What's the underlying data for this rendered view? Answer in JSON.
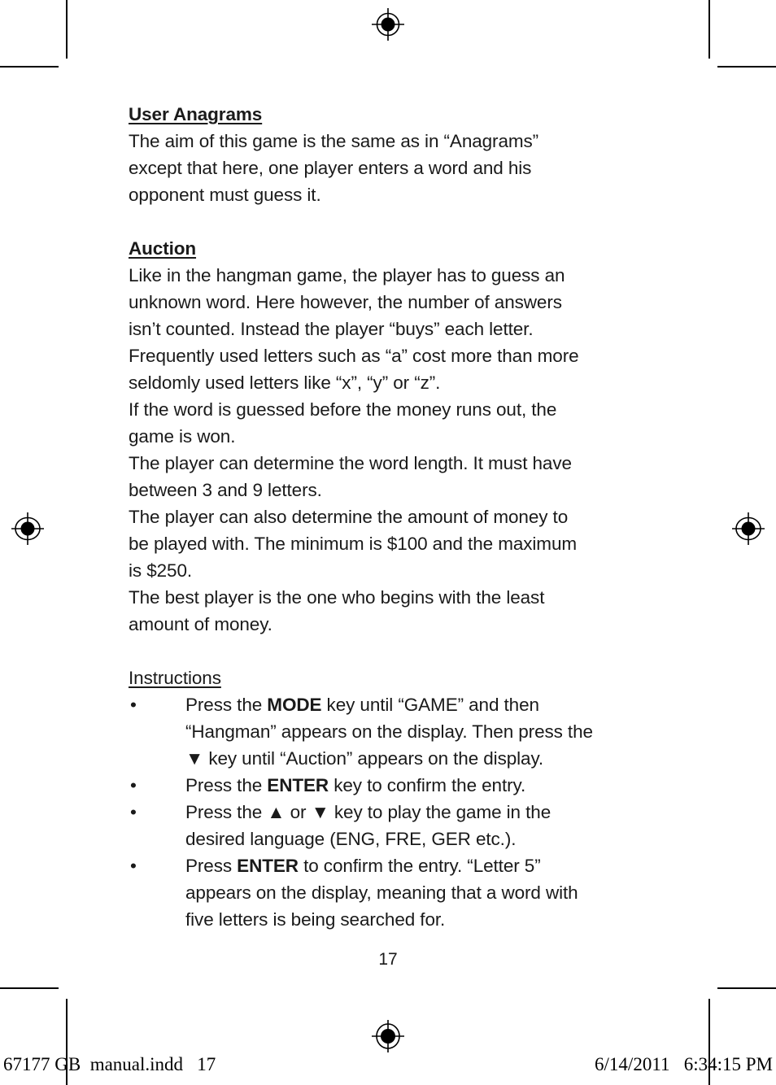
{
  "document": {
    "page_number": "17",
    "sections": [
      {
        "id": "user-anagrams",
        "heading": "User Anagrams",
        "heading_style": "bold-underline",
        "lines": [
          "The aim of this game is the same as in “Anagrams”",
          "except that here, one player enters a word and his",
          "opponent must guess it."
        ]
      },
      {
        "id": "auction",
        "heading": "Auction",
        "heading_style": "bold-underline",
        "lines": [
          "Like in the hangman game, the player has to guess an",
          "unknown word. Here however, the number of answers",
          "isn’t counted. Instead the player “buys” each letter.",
          "Frequently used letters such as “a” cost more than more",
          "seldomly used letters like “x”, “y” or “z”.",
          "If the word is guessed before the money runs out, the",
          "game is won.",
          "The player can determine the word length. It must have",
          "between 3 and 9 letters.",
          "The player can also determine the amount of money to",
          "be played with. The minimum is $100 and the maximum",
          "is $250.",
          "The best player is the one who begins with the least",
          "amount of money."
        ]
      }
    ],
    "instructions": {
      "heading": "Instructions",
      "heading_style": "plain-underline",
      "bullet_glyph": "•",
      "arrow_up_glyph": "▲",
      "arrow_down_glyph": "▼",
      "items": [
        {
          "id": "bullet-mode-key",
          "lines": [
            [
              {
                "t": "Press the ",
                "b": false
              },
              {
                "t": "MODE",
                "b": true
              },
              {
                "t": " key until “GAME” and then",
                "b": false
              }
            ],
            [
              {
                "t": "“Hangman” appears on the display. Then press the",
                "b": false
              }
            ],
            [
              {
                "t": "▼ key until “Auction” appears on the display.",
                "b": false
              }
            ]
          ]
        },
        {
          "id": "bullet-enter-confirm",
          "lines": [
            [
              {
                "t": "Press the ",
                "b": false
              },
              {
                "t": "ENTER",
                "b": true
              },
              {
                "t": " key to confirm the entry.",
                "b": false
              }
            ]
          ]
        },
        {
          "id": "bullet-language-select",
          "lines": [
            [
              {
                "t": "Press the ▲ or ▼ key to play the game in the",
                "b": false
              }
            ],
            [
              {
                "t": "desired language (ENG, FRE, GER etc.).",
                "b": false
              }
            ]
          ]
        },
        {
          "id": "bullet-enter-letter5",
          "lines": [
            [
              {
                "t": "Press ",
                "b": false
              },
              {
                "t": "ENTER",
                "b": true
              },
              {
                "t": " to confirm the entry. “Letter 5”",
                "b": false
              }
            ],
            [
              {
                "t": "appears on the display, meaning that a word with",
                "b": false
              }
            ],
            [
              {
                "t": "five letters is being searched for.",
                "b": false
              }
            ]
          ]
        }
      ]
    }
  },
  "footer": {
    "left": "67177 GB  manual.indd   17",
    "right": "6/14/2011   6:34:15 PM"
  },
  "print_marks": {
    "registration_mark_name": "registration-target-mark",
    "crop_mark_name": "crop-mark"
  }
}
